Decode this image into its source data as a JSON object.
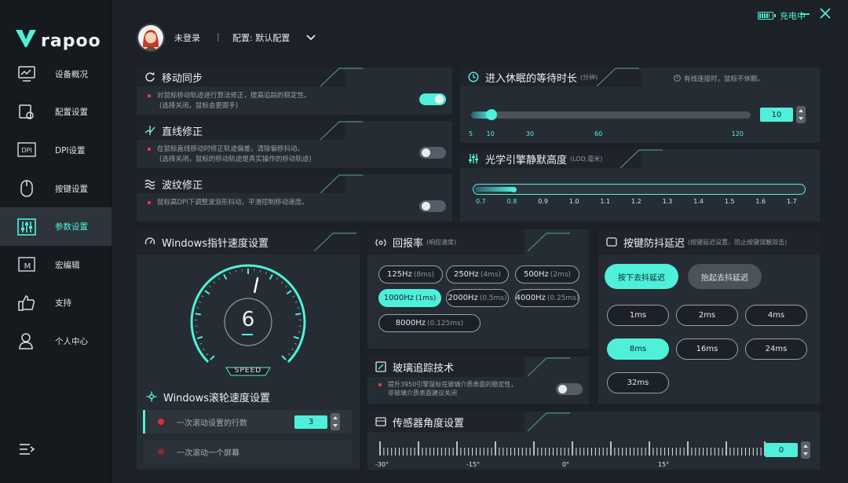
{
  "brand": {
    "name": "rapoo"
  },
  "sidebar": {
    "items": [
      {
        "label": "设备概况",
        "icon": "monitor-chart-icon"
      },
      {
        "label": "配置设置",
        "icon": "config-gear-icon"
      },
      {
        "label": "DPI设置",
        "icon": "dpi-icon"
      },
      {
        "label": "按键设置",
        "icon": "mouse-icon"
      },
      {
        "label": "参数设置",
        "icon": "sliders-icon",
        "active": true
      },
      {
        "label": "宏编辑",
        "icon": "macro-icon"
      },
      {
        "label": "支持",
        "icon": "thumbs-up-icon"
      },
      {
        "label": "个人中心",
        "icon": "user-icon"
      }
    ]
  },
  "header": {
    "login": "未登录",
    "separator": "|",
    "config": "配置: 默认配置",
    "charging": "充电中"
  },
  "motion_sync": {
    "title": "移动同步",
    "desc": "对鼠标移动轨迹进行算法修正，提高追踪的稳定性。",
    "desc2": "(选择关闭，鼠标会更跟手)",
    "enabled": true
  },
  "angle_snap": {
    "title": "直线修正",
    "desc": "在鼠标直线移动时修正轨迹偏差，清除偏移抖动。",
    "desc2": "(选择关闭，鼠标的移动轨迹是真实操作的移动轨迹)",
    "enabled": false
  },
  "ripple": {
    "title": "波纹修正",
    "desc": "鼠标高DPI下调整波浪形抖动，平滑控制移动速度。",
    "enabled": false
  },
  "sleep": {
    "title": "进入休眠的等待时长",
    "unit": "(分钟)",
    "note": "有线连接时，鼠标不休眠。",
    "value": "10",
    "min": 5,
    "max": 120,
    "current": 10,
    "ticks": [
      "5",
      "10",
      "30",
      "60",
      "120"
    ]
  },
  "lod": {
    "title": "光学引擎静默高度",
    "unit": "(LOD,毫米)",
    "value": 0.8,
    "ticks": [
      "0.7",
      "0.8",
      "0.9",
      "1.0",
      "1.1",
      "1.2",
      "1.3",
      "1.4",
      "1.5",
      "1.6",
      "1.7"
    ]
  },
  "pointer_speed": {
    "title": "Windows指针速度设置",
    "value": "6",
    "max": 11,
    "label": "SPEED"
  },
  "scroll_speed": {
    "title": "Windows滚轮速度设置",
    "rows": [
      {
        "label": "一次滚动设置的行数",
        "value": "3",
        "active": true
      },
      {
        "label": "一次滚动一个屏幕",
        "active": false
      }
    ]
  },
  "polling": {
    "title": "回报率",
    "unit": "(响应速度)",
    "options": [
      {
        "rate": "125Hz",
        "ms": "(8ms)"
      },
      {
        "rate": "250Hz",
        "ms": "(4ms)"
      },
      {
        "rate": "500Hz",
        "ms": "(2ms)"
      },
      {
        "rate": "1000Hz",
        "ms": "(1ms)",
        "selected": true
      },
      {
        "rate": "2000Hz",
        "ms": "(0.5ms)"
      },
      {
        "rate": "4000Hz",
        "ms": "(0.25ms)"
      },
      {
        "rate": "8000Hz",
        "ms": "(0.125ms)"
      }
    ]
  },
  "debounce": {
    "title": "按键防抖延迟",
    "unit": "(按键延迟设置，防止按键误触双击)",
    "press_label": "按下去抖延迟",
    "release_label": "抬起去抖延迟",
    "options": [
      "1ms",
      "2ms",
      "4ms",
      "8ms",
      "16ms",
      "24ms",
      "32ms"
    ],
    "selected": "8ms"
  },
  "glass": {
    "title": "玻璃追踪技术",
    "desc": "提升3950引擎鼠标在玻璃介质表面的稳定性，",
    "desc2": "非玻璃介质表面建议关闭",
    "enabled": false
  },
  "sensor_angle": {
    "title": "传感器角度设置",
    "value": "0",
    "ticks": [
      "-30°",
      "-15°",
      "0°",
      "15°"
    ]
  },
  "colors": {
    "accent": "#4ff0da",
    "panel": "#262c33",
    "background": "#1c2127",
    "red": "#ff3b47"
  }
}
